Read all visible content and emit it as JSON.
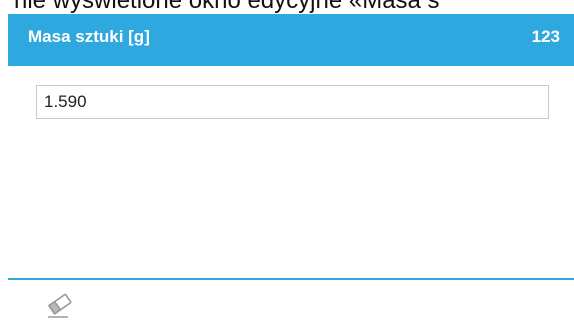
{
  "caption": {
    "text": "nie wyświetlone okno edycyjne «Masa s"
  },
  "dialog": {
    "title": "Masa sztuki [g]",
    "code": "123"
  },
  "field": {
    "value": "1.590"
  },
  "toolbar": {
    "clear_icon": "eraser-icon"
  },
  "colors": {
    "accent": "#2fa8e0",
    "field_border": "#c9c9c9",
    "icon": "#9a9a9a"
  }
}
